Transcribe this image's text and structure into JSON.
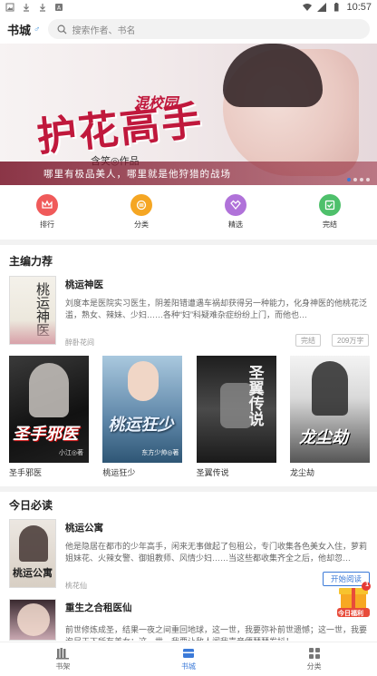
{
  "status_bar": {
    "time": "10:57"
  },
  "header": {
    "title": "书城",
    "gender_symbol": "♂",
    "search_placeholder": "搜索作者、书名"
  },
  "banner": {
    "subtitle": "混校园",
    "title": "护花高手",
    "author_line": "含笑◎作品",
    "slogan": "哪里有极品美人，哪里就是他狩猎的战场"
  },
  "quick_nav": [
    {
      "label": "排行",
      "color": "#f05a5a",
      "icon": "crown-icon"
    },
    {
      "label": "分类",
      "color": "#f5a623",
      "icon": "category-icon"
    },
    {
      "label": "精选",
      "color": "#b072d9",
      "icon": "heart-icon"
    },
    {
      "label": "完结",
      "color": "#4ec06b",
      "icon": "check-icon"
    }
  ],
  "editor_picks": {
    "title": "主编力荐",
    "featured": {
      "name": "桃运神医",
      "desc": "刘度本是医院实习医生，阴差阳错遭遇车祸却获得另一种能力，化身神医的他桃花泛滥，熟女、辣妹、少妇……各种“妇”科疑难杂症纷纷上门，而他也…",
      "author": "醉卧花间",
      "tag1": "完结",
      "tag2": "209万字",
      "cover_text": "桃运神医"
    },
    "grid": [
      {
        "name": "圣手邪医",
        "cover_text": "圣手邪医",
        "cover_author": "小江◎著"
      },
      {
        "name": "桃运狂少",
        "cover_text": "桃运狂少",
        "cover_author": "东方少帅◎著"
      },
      {
        "name": "圣翼传说",
        "cover_text": "圣翼传说",
        "cover_author": ""
      },
      {
        "name": "龙尘劫",
        "cover_text": "龙尘劫",
        "cover_author": ""
      }
    ]
  },
  "today": {
    "title": "今日必读",
    "books": [
      {
        "name": "桃运公寓",
        "desc": "他是隐居在都市的少年高手，闲来无事做起了包租公，专门收集各色美女入住，萝莉姐妹花、火辣女警、御姐教师、风情少妇……当这些都收集齐全之后，他却忽…",
        "author": "桃花仙",
        "cover_text": "桃运公寓"
      },
      {
        "name": "重生之合租医仙",
        "desc": "前世修炼成圣，结果一夜之间重回地球，这一世，我要弥补前世遗憾；这一世，我要泡尽天下所有美女；这一世，我要让敌人闻我声音便瑟瑟发抖！…",
        "author": "",
        "cover_text": ""
      }
    ],
    "read_btn": "开始阅读"
  },
  "gift_label": "今日福利",
  "gift_badge": "1",
  "tabbar": [
    {
      "label": "书架",
      "icon": "bookshelf-icon",
      "active": false
    },
    {
      "label": "书城",
      "icon": "store-icon",
      "active": true
    },
    {
      "label": "分类",
      "icon": "grid-icon",
      "active": false
    }
  ]
}
